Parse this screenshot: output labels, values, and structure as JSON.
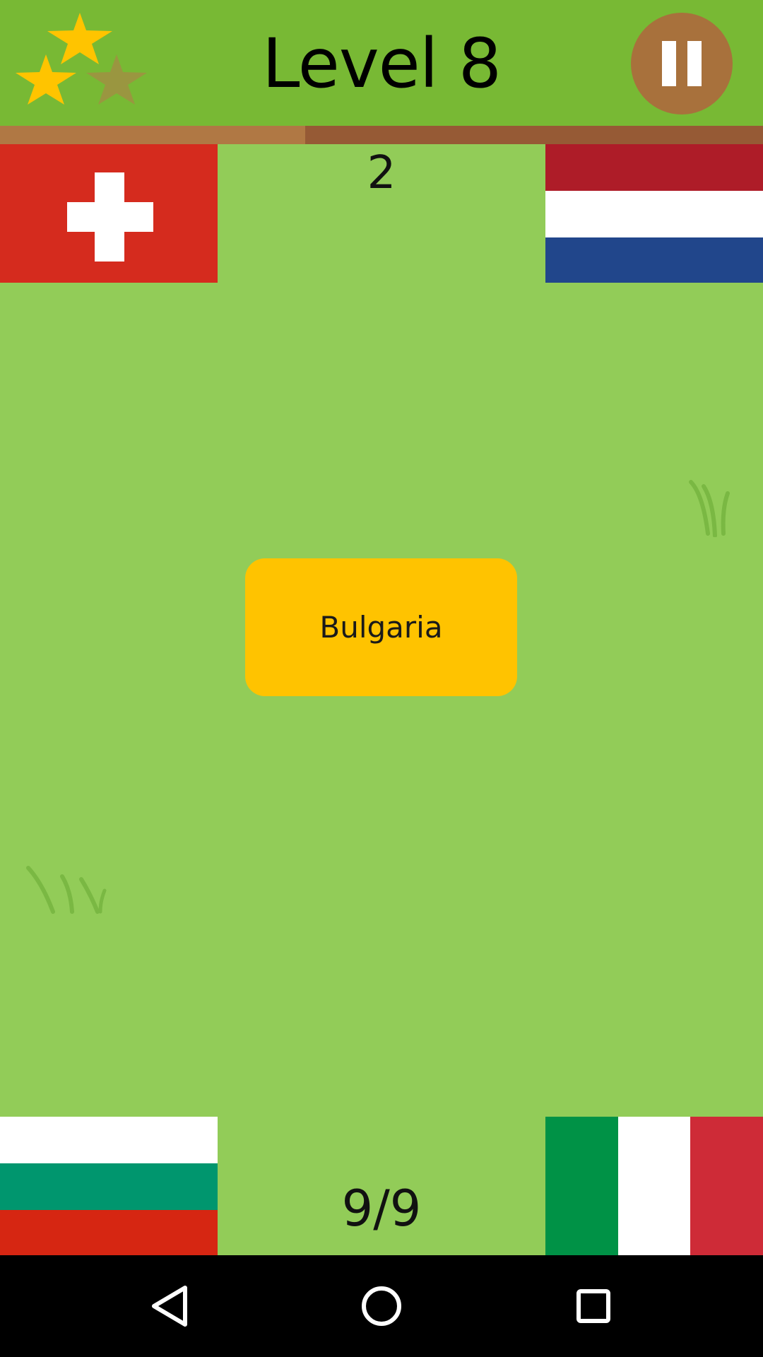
{
  "header": {
    "title": "Level 8",
    "stars_earned": 2,
    "stars_total": 3,
    "star_color_earned": "#ffc400",
    "star_color_empty": "#9a9640"
  },
  "progress": {
    "fraction": 0.4
  },
  "game": {
    "score": "2",
    "counter": "9/9",
    "current_country": "Bulgaria",
    "flags": [
      {
        "country": "Switzerland",
        "position": "top-left"
      },
      {
        "country": "Netherlands",
        "position": "top-right"
      },
      {
        "country": "Bulgaria",
        "position": "bottom-left"
      },
      {
        "country": "Italy",
        "position": "bottom-right"
      }
    ]
  },
  "colors": {
    "background": "#92cc58",
    "topbar": "#78b934",
    "card": "#ffc300",
    "pause_button": "#a8713c"
  },
  "navigation": {
    "buttons": [
      "back-icon",
      "home-icon",
      "recents-icon"
    ]
  }
}
